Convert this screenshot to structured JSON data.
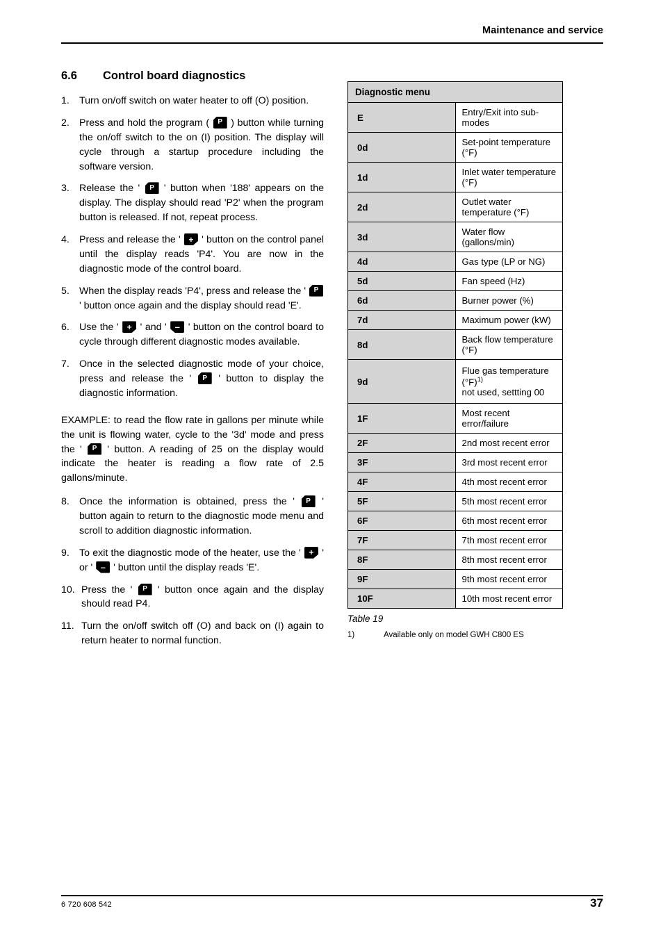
{
  "header": {
    "title": "Maintenance and service"
  },
  "footer": {
    "doc_number": "6 720 608 542",
    "page_number": "37"
  },
  "section": {
    "number": "6.6",
    "title": "Control board diagnostics"
  },
  "icons": {
    "program_label": "P",
    "plus_label": "+",
    "minus_label": "–"
  },
  "steps": [
    {
      "num": "1.",
      "parts": [
        {
          "t": "text",
          "v": "Turn on/off switch on water heater to off (O) position."
        }
      ]
    },
    {
      "num": "2.",
      "parts": [
        {
          "t": "text",
          "v": "Press and hold the program ( "
        },
        {
          "t": "icon",
          "v": "p"
        },
        {
          "t": "text",
          "v": " ) button while turning the on/off switch to the on (I) position. The display will cycle through a startup procedure including the software version."
        }
      ]
    },
    {
      "num": "3.",
      "parts": [
        {
          "t": "text",
          "v": "Release the ' "
        },
        {
          "t": "icon",
          "v": "p"
        },
        {
          "t": "text",
          "v": " ' button when '188' appears on the display. The display should read 'P2' when the program button is released. If not, repeat process."
        }
      ]
    },
    {
      "num": "4.",
      "parts": [
        {
          "t": "text",
          "v": "Press and release the ' "
        },
        {
          "t": "icon",
          "v": "plus"
        },
        {
          "t": "text",
          "v": " ' button on the control panel until the display reads 'P4'. You are now in the diagnostic mode of the control board."
        }
      ]
    },
    {
      "num": "5.",
      "parts": [
        {
          "t": "text",
          "v": "When the display reads 'P4', press and release the ' "
        },
        {
          "t": "icon",
          "v": "p"
        },
        {
          "t": "text",
          "v": " ' button once again and the display should read 'E'."
        }
      ]
    },
    {
      "num": "6.",
      "parts": [
        {
          "t": "text",
          "v": "Use the ' "
        },
        {
          "t": "icon",
          "v": "plus"
        },
        {
          "t": "text",
          "v": " ' and ' "
        },
        {
          "t": "icon",
          "v": "minus"
        },
        {
          "t": "text",
          "v": " ' button on the control board to cycle through different diagnostic modes available."
        }
      ]
    },
    {
      "num": "7.",
      "parts": [
        {
          "t": "text",
          "v": "Once in the selected diagnostic mode of your choice, press and release the ' "
        },
        {
          "t": "icon",
          "v": "p"
        },
        {
          "t": "text",
          "v": " ' button to display the diagnostic information."
        }
      ]
    }
  ],
  "example": {
    "parts": [
      {
        "t": "text",
        "v": "EXAMPLE: to read the flow rate in gallons per minute while the unit is flowing water, cycle to the '3d' mode and press the ' "
      },
      {
        "t": "icon",
        "v": "p"
      },
      {
        "t": "text",
        "v": " ' button. A reading of 25 on the display would indicate the heater is reading a flow rate of 2.5 gallons/minute."
      }
    ]
  },
  "steps_after": [
    {
      "num": "8.",
      "parts": [
        {
          "t": "text",
          "v": "Once the information is obtained, press the ' "
        },
        {
          "t": "icon",
          "v": "p"
        },
        {
          "t": "text",
          "v": " ' button again to return to the diagnostic mode menu and scroll to addition diagnostic information."
        }
      ]
    },
    {
      "num": "9.",
      "parts": [
        {
          "t": "text",
          "v": "To exit the diagnostic mode of the heater, use the ' "
        },
        {
          "t": "icon",
          "v": "plus"
        },
        {
          "t": "text",
          "v": " ' or ' "
        },
        {
          "t": "icon",
          "v": "minus"
        },
        {
          "t": "text",
          "v": " ' button until the display reads 'E'."
        }
      ]
    },
    {
      "num": "10.",
      "parts": [
        {
          "t": "text",
          "v": "Press the ' "
        },
        {
          "t": "icon",
          "v": "p"
        },
        {
          "t": "text",
          "v": " ' button once again and the display should read P4."
        }
      ]
    },
    {
      "num": "11.",
      "parts": [
        {
          "t": "text",
          "v": "Turn the on/off switch off (O) and back on (I) again to return heater to normal function."
        }
      ]
    }
  ],
  "table": {
    "header": "Diagnostic menu",
    "caption": "Table 19",
    "footnote_mark": "1)",
    "footnote_text": "Available only on model GWH C800 ES",
    "rows": [
      {
        "code": "E",
        "desc": "Entry/Exit into sub-modes"
      },
      {
        "code": "0d",
        "desc": "Set-point temperature (°F)"
      },
      {
        "code": "1d",
        "desc": "Inlet water temperature (°F)"
      },
      {
        "code": "2d",
        "desc": "Outlet water temperature (°F)"
      },
      {
        "code": "3d",
        "desc": "Water flow (gallons/min)"
      },
      {
        "code": "4d",
        "desc": "Gas type (LP or NG)"
      },
      {
        "code": "5d",
        "desc": "Fan speed (Hz)"
      },
      {
        "code": "6d",
        "desc": "Burner power (%)"
      },
      {
        "code": "7d",
        "desc": "Maximum power (kW)"
      },
      {
        "code": "8d",
        "desc": "Back flow temperature (°F)"
      },
      {
        "code": "9d",
        "desc": "Flue gas temperature (°F)",
        "sup": "1)",
        "desc2": "not used, settting 00",
        "tall": true
      },
      {
        "code": "1F",
        "desc": "Most recent error/failure"
      },
      {
        "code": "2F",
        "desc": "2nd most recent error"
      },
      {
        "code": "3F",
        "desc": "3rd most recent error"
      },
      {
        "code": "4F",
        "desc": "4th most recent error"
      },
      {
        "code": "5F",
        "desc": "5th most recent error"
      },
      {
        "code": "6F",
        "desc": "6th most recent error"
      },
      {
        "code": "7F",
        "desc": "7th most recent error"
      },
      {
        "code": "8F",
        "desc": "8th most recent error"
      },
      {
        "code": "9F",
        "desc": "9th most recent error"
      },
      {
        "code": "10F",
        "desc": "10th most recent error"
      }
    ]
  }
}
